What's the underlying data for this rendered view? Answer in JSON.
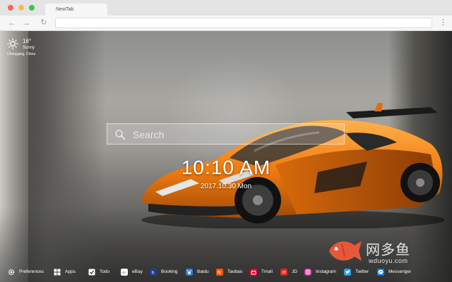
{
  "browser": {
    "tab_title": "NewTab",
    "url": ""
  },
  "weather": {
    "temperature": "16°",
    "condition": "Sunny",
    "location": "Chongqing, China",
    "icon": "sun-icon"
  },
  "search": {
    "placeholder": "Search"
  },
  "clock": {
    "time": "10:10 AM",
    "date": "2017.10.30 Mon"
  },
  "watermark": {
    "cn": "网多鱼",
    "en": "wduoyu.com"
  },
  "bottom_bar": {
    "items": [
      {
        "label": "Preferences",
        "icon": "gear-icon",
        "color": "#ffffff"
      },
      {
        "label": "Apps",
        "icon": "apps-grid-icon",
        "color": "#ffffff"
      },
      {
        "label": "Todo",
        "icon": "checkbox-icon",
        "color": "#ffffff"
      },
      {
        "label": "eBay",
        "icon": "ebay-icon",
        "color": "#ffffff"
      },
      {
        "label": "Booking",
        "icon": "booking-icon",
        "color": "#1e3f8a"
      },
      {
        "label": "Baidu",
        "icon": "baidu-icon",
        "color": "#2a7de1"
      },
      {
        "label": "Taobao",
        "icon": "taobao-icon",
        "color": "#ff5000"
      },
      {
        "label": "Tmall",
        "icon": "tmall-icon",
        "color": "#e4002b"
      },
      {
        "label": "JD",
        "icon": "jd-icon",
        "color": "#e1251b"
      },
      {
        "label": "Instagram",
        "icon": "instagram-icon",
        "color": "#d6249f"
      },
      {
        "label": "Twitter",
        "icon": "twitter-icon",
        "color": "#1da1f2"
      },
      {
        "label": "Messenger",
        "icon": "messenger-icon",
        "color": "#0084ff"
      }
    ]
  }
}
